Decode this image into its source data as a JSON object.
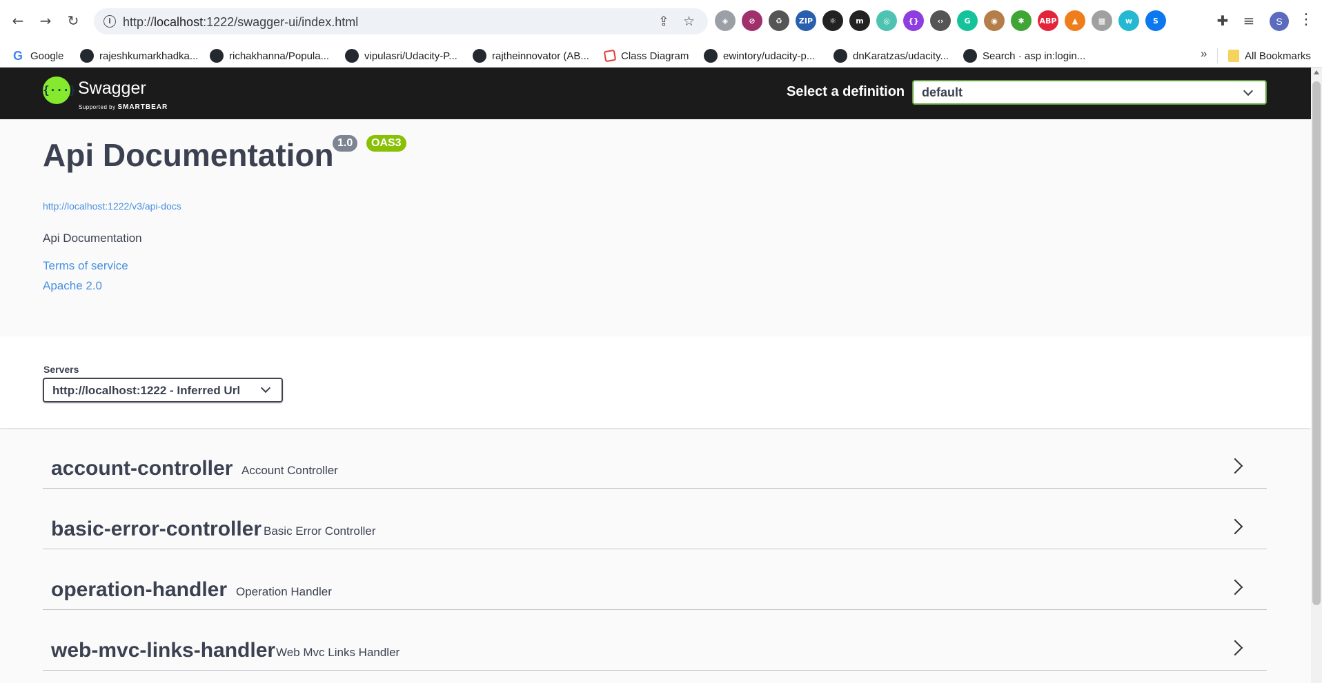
{
  "browser": {
    "url_prefix": "http://",
    "url_host": "localhost",
    "url_rest": ":1222/swagger-ui/index.html",
    "extensions": [
      {
        "name": "shield-extension-icon",
        "color": "#9aa0a6",
        "glyph": "◈"
      },
      {
        "name": "block-extension-icon",
        "color": "#a0306b",
        "glyph": "⊘"
      },
      {
        "name": "recycle-extension-icon",
        "color": "#555555",
        "glyph": "♻"
      },
      {
        "name": "zip-extension-icon",
        "color": "#2a5fb0",
        "glyph": "ZIP"
      },
      {
        "name": "react-devtools-extension-icon",
        "color": "#222222",
        "glyph": "⚛"
      },
      {
        "name": "m-extension-icon",
        "color": "#222222",
        "glyph": "m"
      },
      {
        "name": "circle-extension-icon",
        "color": "#4fc3b1",
        "glyph": "◎"
      },
      {
        "name": "purple-extension-icon",
        "color": "#8e3ee0",
        "glyph": "{}"
      },
      {
        "name": "bracket-extension-icon",
        "color": "#555555",
        "glyph": "‹›"
      },
      {
        "name": "grammarly-extension-icon",
        "color": "#15c39a",
        "glyph": "G"
      },
      {
        "name": "owl-extension-icon",
        "color": "#b57d4a",
        "glyph": "◉"
      },
      {
        "name": "bug-extension-icon",
        "color": "#3fa535",
        "glyph": "✱"
      },
      {
        "name": "adblock-extension-icon",
        "color": "#e4243b",
        "glyph": "ABP"
      },
      {
        "name": "fox-extension-icon",
        "color": "#f07d1b",
        "glyph": "▲"
      },
      {
        "name": "grid-extension-icon",
        "color": "#a0a0a0",
        "glyph": "▦"
      },
      {
        "name": "w-extension-icon",
        "color": "#24b8d3",
        "glyph": "w"
      },
      {
        "name": "shazam-extension-icon",
        "color": "#0b78f0",
        "glyph": "S"
      }
    ],
    "profile_initial": "S",
    "bookmarks": [
      {
        "label": "Google",
        "icon": "google"
      },
      {
        "label": "rajeshkumarkhadka...",
        "icon": "github"
      },
      {
        "label": "richakhanna/Popula...",
        "icon": "github"
      },
      {
        "label": "vipulasri/Udacity-P...",
        "icon": "github"
      },
      {
        "label": "rajtheinnovator (AB...",
        "icon": "github"
      },
      {
        "label": "Class Diagram",
        "icon": "diagram"
      },
      {
        "label": "ewintory/udacity-p...",
        "icon": "github"
      },
      {
        "label": "dnKaratzas/udacity...",
        "icon": "github"
      },
      {
        "label": "Search · asp in:login...",
        "icon": "github"
      }
    ],
    "more_bookmarks": "»",
    "all_bookmarks": "All Bookmarks"
  },
  "swagger": {
    "brand": "Swagger",
    "brand_sub_prefix": "Supported by",
    "brand_sub_name": "SMARTBEAR",
    "logo_glyph": "{···}",
    "definition_label": "Select a definition",
    "definition_value": "default",
    "title": "Api Documentation",
    "version": "1.0",
    "oas": "OAS3",
    "spec_url": "http://localhost:1222/v3/api-docs",
    "description": "Api Documentation",
    "terms": "Terms of service",
    "license": "Apache 2.0",
    "servers_label": "Servers",
    "server_value": "http://localhost:1222 - Inferred Url",
    "tags": [
      {
        "name": "account-controller",
        "desc": "Account Controller"
      },
      {
        "name": "basic-error-controller",
        "desc": "Basic Error Controller"
      },
      {
        "name": "operation-handler",
        "desc": "Operation Handler"
      },
      {
        "name": "web-mvc-links-handler",
        "desc": "Web Mvc Links Handler"
      }
    ]
  }
}
